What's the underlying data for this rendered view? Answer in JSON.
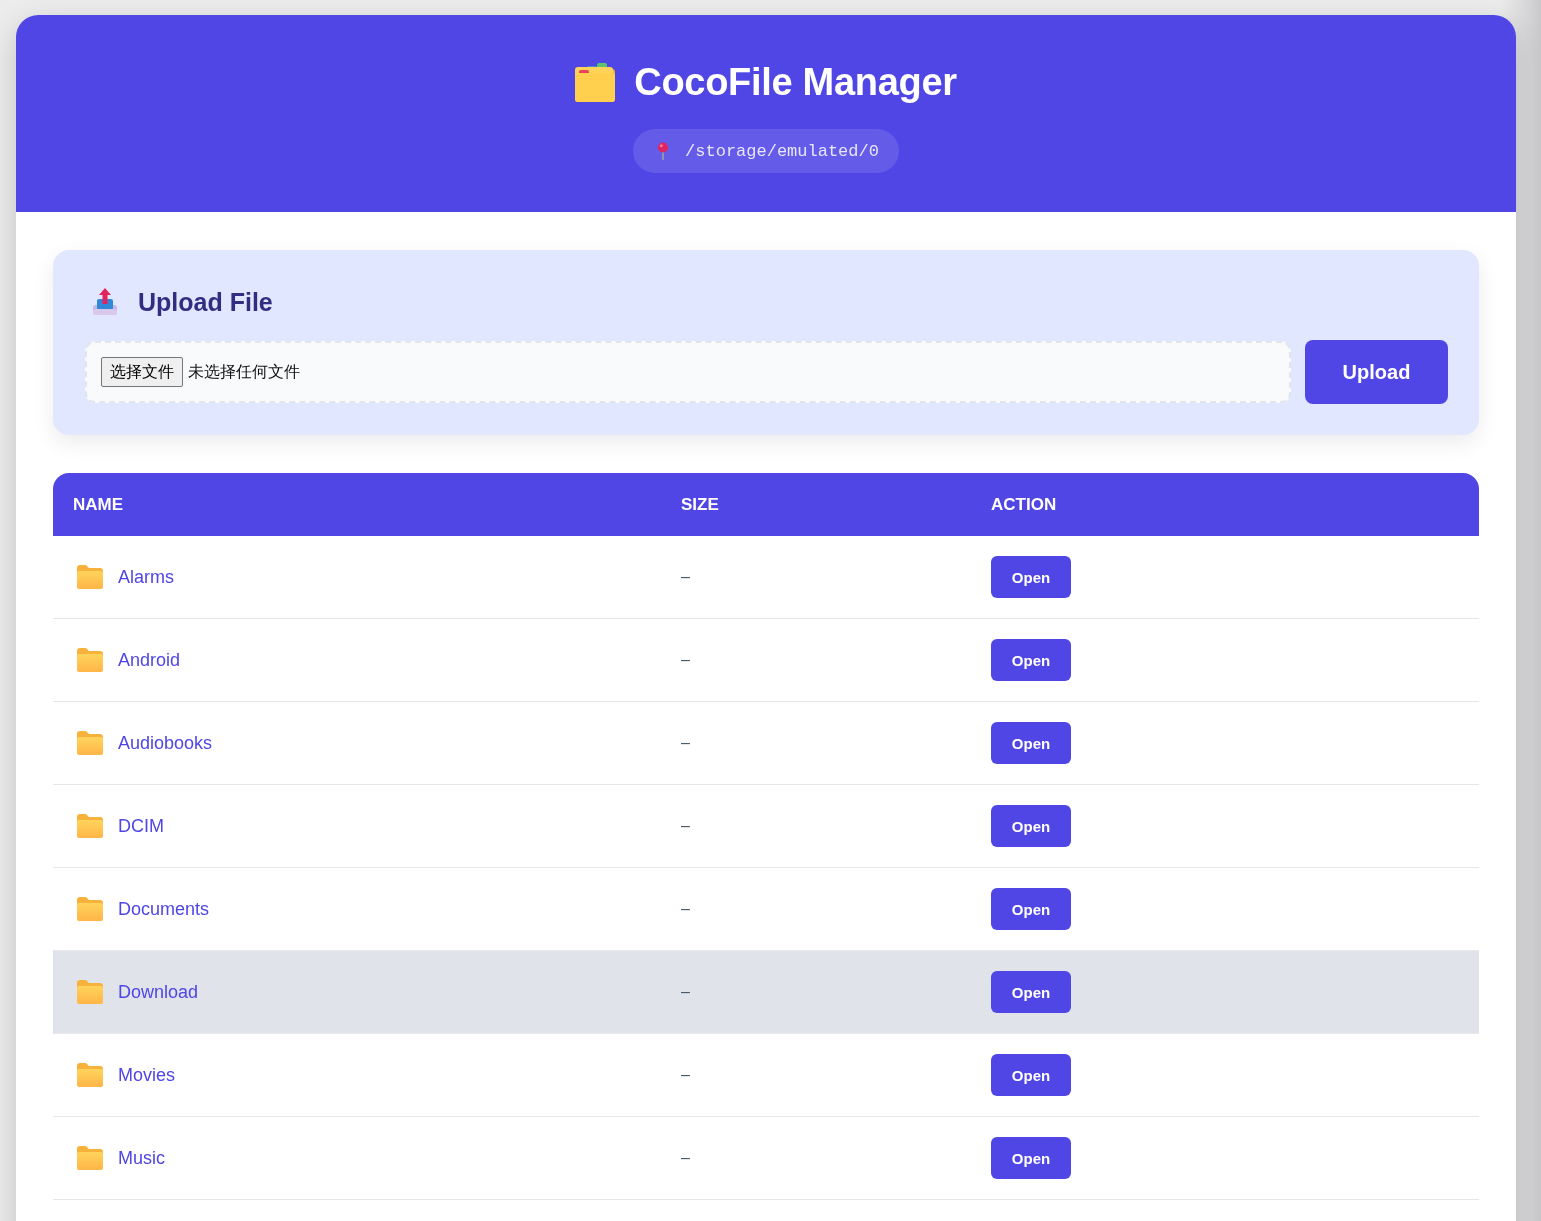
{
  "app": {
    "title": "CocoFile Manager",
    "path": "/storage/emulated/0"
  },
  "upload": {
    "title": "Upload File",
    "choose_button": "选择文件",
    "file_status": "未选择任何文件",
    "button": "Upload"
  },
  "table": {
    "columns": [
      "NAME",
      "SIZE",
      "ACTION"
    ],
    "rows": [
      {
        "kind": "folder",
        "name": "Alarms",
        "size": "–",
        "action": "Open",
        "highlighted": false
      },
      {
        "kind": "folder",
        "name": "Android",
        "size": "–",
        "action": "Open",
        "highlighted": false
      },
      {
        "kind": "folder",
        "name": "Audiobooks",
        "size": "–",
        "action": "Open",
        "highlighted": false
      },
      {
        "kind": "folder",
        "name": "DCIM",
        "size": "–",
        "action": "Open",
        "highlighted": false
      },
      {
        "kind": "folder",
        "name": "Documents",
        "size": "–",
        "action": "Open",
        "highlighted": false
      },
      {
        "kind": "folder",
        "name": "Download",
        "size": "–",
        "action": "Open",
        "highlighted": true
      },
      {
        "kind": "folder",
        "name": "Movies",
        "size": "–",
        "action": "Open",
        "highlighted": false
      },
      {
        "kind": "folder",
        "name": "Music",
        "size": "–",
        "action": "Open",
        "highlighted": false
      }
    ]
  }
}
